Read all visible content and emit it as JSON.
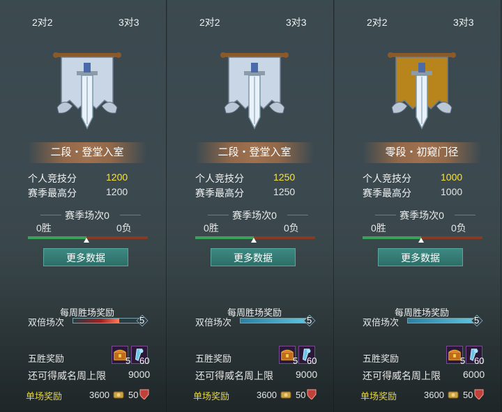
{
  "panels": [
    {
      "tab_2v2": "2对2",
      "tab_3v3": "3对3",
      "banner_color": "#c9d6e6",
      "rank_title": "二段・登堂入室",
      "personal_label": "个人竞技分",
      "personal_value": "1200",
      "season_high_label": "赛季最高分",
      "season_high_value": "1200",
      "season_games": "赛季场次0",
      "wins": "0胜",
      "losses": "0负",
      "more_data": "更多数据",
      "weekly_reward_title": "每周胜场奖励",
      "double_label": "双倍场次",
      "double_count": "5",
      "double_fill": 0.0,
      "double_highlight": true,
      "five_win_label": "五胜奖励",
      "item1_count": "5",
      "item2_count": "60",
      "prestige_label": "还可得威名周上限",
      "prestige_value": "9000",
      "single_label": "单场奖励",
      "single_v1": "3600",
      "single_v2": "50"
    },
    {
      "tab_2v2": "2对2",
      "tab_3v3": "3对3",
      "banner_color": "#c9d6e6",
      "rank_title": "二段・登堂入室",
      "personal_label": "个人竞技分",
      "personal_value": "1250",
      "season_high_label": "赛季最高分",
      "season_high_value": "1250",
      "season_games": "赛季场次0",
      "wins": "0胜",
      "losses": "0负",
      "more_data": "更多数据",
      "weekly_reward_title": "每周胜场奖励",
      "double_label": "双倍场次",
      "double_count": "5",
      "double_fill": 1.0,
      "double_highlight": false,
      "five_win_label": "五胜奖励",
      "item1_count": "5",
      "item2_count": "60",
      "prestige_label": "还可得威名周上限",
      "prestige_value": "9000",
      "single_label": "单场奖励",
      "single_v1": "3600",
      "single_v2": "50"
    },
    {
      "tab_2v2": "2对2",
      "tab_3v3": "3对3",
      "banner_color": "#b8851c",
      "rank_title": "零段・初窥门径",
      "personal_label": "个人竞技分",
      "personal_value": "1000",
      "season_high_label": "赛季最高分",
      "season_high_value": "1000",
      "season_games": "赛季场次0",
      "wins": "0胜",
      "losses": "0负",
      "more_data": "更多数据",
      "weekly_reward_title": "每周胜场奖励",
      "double_label": "双倍场次",
      "double_count": "5",
      "double_fill": 1.0,
      "double_highlight": false,
      "five_win_label": "五胜奖励",
      "item1_count": "5",
      "item2_count": "60",
      "prestige_label": "还可得威名周上限",
      "prestige_value": "6000",
      "single_label": "单场奖励",
      "single_v1": "3600",
      "single_v2": "50"
    }
  ]
}
